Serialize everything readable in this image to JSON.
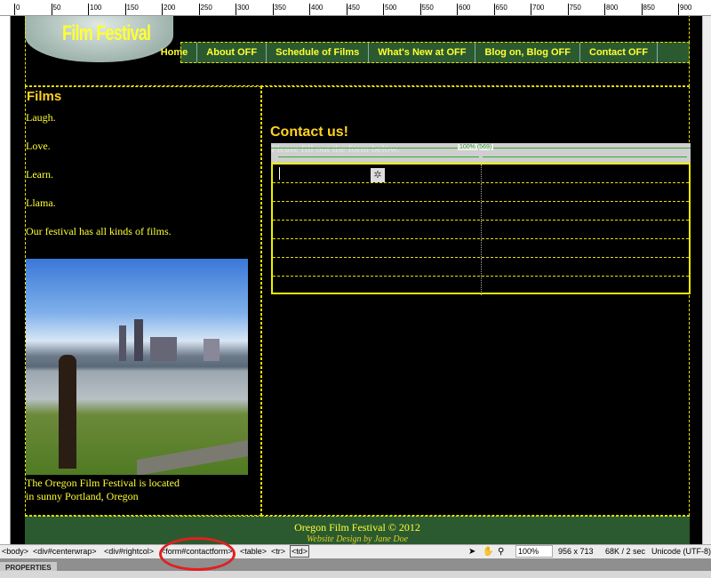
{
  "ruler": {
    "labels": [
      "0",
      "50",
      "100",
      "150",
      "200",
      "250",
      "300",
      "350",
      "400",
      "450",
      "500",
      "550",
      "600",
      "650",
      "700",
      "750",
      "800",
      "850",
      "900"
    ]
  },
  "header": {
    "logo_text": "Film Festival"
  },
  "nav": {
    "items": [
      "Home",
      "About OFF",
      "Schedule of Films",
      "What's New at OFF",
      "Blog on, Blog OFF",
      "Contact OFF"
    ]
  },
  "left": {
    "title": "Films",
    "paragraphs": [
      "Laugh.",
      "Love.",
      "Learn.",
      "Llama.",
      "Our festival has all kinds of films."
    ],
    "caption_line1": "The Oregon Film Festival is located",
    "caption_line2": "in sunny Portland, Oregon"
  },
  "right": {
    "title": "Contact us!",
    "hint": "Please fill out the form below.",
    "width_label": "100% (569)"
  },
  "footer": {
    "copyright": "Oregon Film Festival © 2012",
    "credit": "Website Design by Jane Doe"
  },
  "status": {
    "tags": [
      "<body>",
      "<div#centerwrap>",
      "<div#rightcol>",
      "<form#contactform>",
      "<table>",
      "<tr>",
      "<td>"
    ],
    "zoom": "100%",
    "size": "956 x 713",
    "download": "68K / 2 sec",
    "encoding": "Unicode (UTF-8)"
  },
  "panel": {
    "properties": "PROPERTIES"
  },
  "colors": {
    "accent": "#ffff33",
    "nav_bg": "#2b5a30",
    "annotation": "#e02020"
  }
}
